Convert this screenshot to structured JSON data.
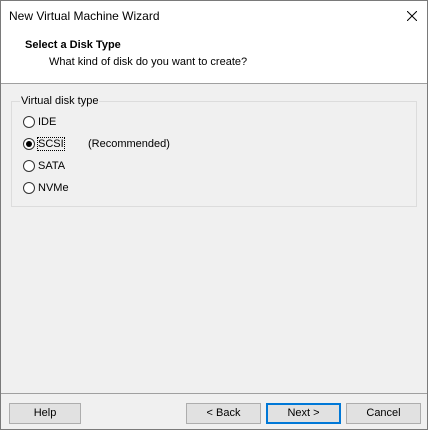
{
  "window": {
    "title": "New Virtual Machine Wizard"
  },
  "header": {
    "title": "Select a Disk Type",
    "subtitle": "What kind of disk do you want to create?"
  },
  "disk_type": {
    "group_label": "Virtual disk type",
    "options": [
      {
        "label": "IDE",
        "selected": false
      },
      {
        "label": "SCSI",
        "selected": true,
        "note": "(Recommended)"
      },
      {
        "label": "SATA",
        "selected": false
      },
      {
        "label": "NVMe",
        "selected": false
      }
    ]
  },
  "footer": {
    "help_label": "Help",
    "back_label": "< Back",
    "next_label": "Next >",
    "cancel_label": "Cancel"
  },
  "colors": {
    "accent": "#0078d7",
    "background": "#f0f0f0"
  },
  "icons": {
    "close": "close-icon"
  }
}
